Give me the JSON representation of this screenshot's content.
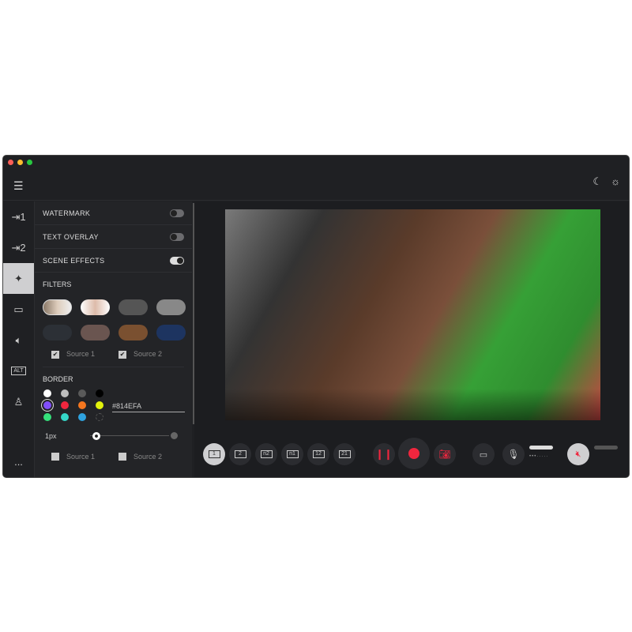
{
  "window": {
    "traffic": [
      "#fe5f57",
      "#febc2e",
      "#28c840"
    ]
  },
  "header": {
    "menu_icon": "hamburger-icon",
    "theme_dark": "moon-icon",
    "theme_light": "sun-icon"
  },
  "rail": [
    "input-1-icon",
    "input-2-icon",
    "magic-wand-icon",
    "camera-icon",
    "speaker-icon",
    "alt-icon",
    "user-icon"
  ],
  "rail_alt": "ALT",
  "rail_more": "...",
  "panel": {
    "watermark": {
      "label": "WATERMARK",
      "on": false
    },
    "text_overlay": {
      "label": "TEXT OVERLAY",
      "on": false
    },
    "scene_effects": {
      "label": "SCENE EFFECTS",
      "on": true
    },
    "filters": {
      "label": "FILTERS",
      "sources": [
        {
          "label": "Source 1",
          "checked": true
        },
        {
          "label": "Source 2",
          "checked": true
        }
      ]
    },
    "border": {
      "label": "BORDER",
      "colors": [
        "#ffffff",
        "#bdbdbd",
        "#5a5a5a",
        "#000000",
        "#814efa",
        "#f0263e",
        "#f5771f",
        "#e2f20c",
        "#35e07a",
        "#35d8c8",
        "#2fa3e0",
        "transparent"
      ],
      "selected": "#814EFA",
      "hex_value": "#814EFA",
      "width_label": "1px",
      "sources": [
        {
          "label": "Source 1",
          "checked": false
        },
        {
          "label": "Source 2",
          "checked": false
        }
      ]
    }
  },
  "toolbar": {
    "layouts": [
      "1",
      "2",
      "n2",
      "n1",
      "12",
      "21"
    ],
    "selected_layout": 0,
    "accent": "#f0263e",
    "mic_level": 0.9,
    "speaker_level": 0.9,
    "speaker_muted": true
  }
}
